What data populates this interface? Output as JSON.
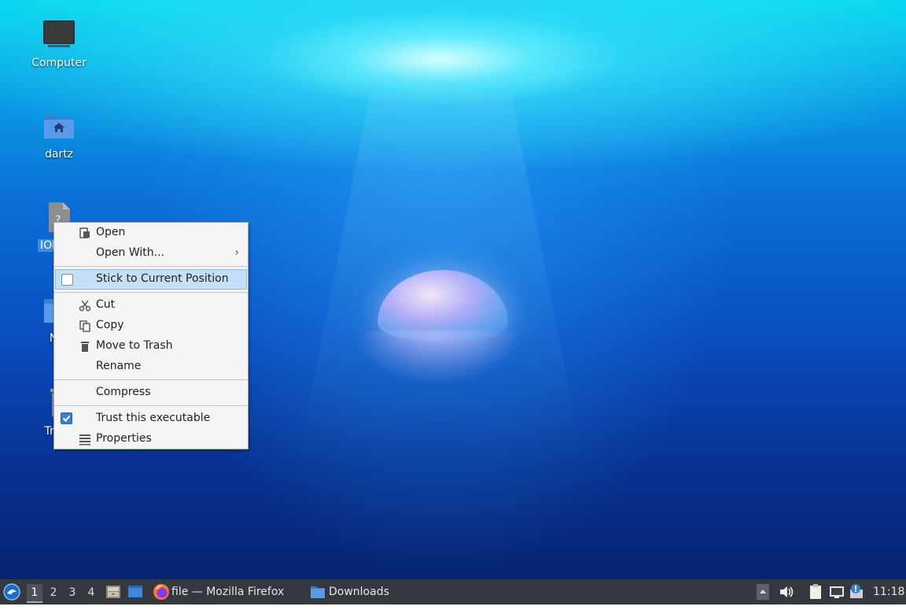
{
  "desktop": {
    "icons": [
      {
        "label": "Computer"
      },
      {
        "label": "dartz"
      },
      {
        "label": "IObit U"
      },
      {
        "label": "Net"
      },
      {
        "label": "Trash"
      }
    ]
  },
  "context_menu": {
    "items": [
      {
        "label": "Open",
        "icon": "open-icon"
      },
      {
        "label": "Open With...",
        "submenu": true
      },
      {
        "label": "Stick to Current Position",
        "checkbox": true,
        "checked": false,
        "highlighted": true
      },
      {
        "label": "Cut",
        "icon": "scissors-icon"
      },
      {
        "label": "Copy",
        "icon": "copy-icon"
      },
      {
        "label": "Move to Trash",
        "icon": "trash-icon"
      },
      {
        "label": "Rename"
      },
      {
        "label": "Compress"
      },
      {
        "label": "Trust this executable",
        "checkbox": true,
        "checked": true
      },
      {
        "label": "Properties",
        "icon": "properties-icon"
      }
    ],
    "submenu_arrow": "›"
  },
  "taskbar": {
    "workspaces": [
      "1",
      "2",
      "3",
      "4"
    ],
    "active_workspace": "1",
    "tasks": [
      {
        "label": "file — Mozilla Firefox",
        "icon": "firefox-icon"
      },
      {
        "label": "Downloads",
        "icon": "folder-icon"
      }
    ],
    "clock": "11:18"
  },
  "colors": {
    "taskbar_bg": "#33393f",
    "menu_bg": "#f5f5f5",
    "menu_highlight": "#c4e0f7",
    "selection": "#3c8be0"
  }
}
